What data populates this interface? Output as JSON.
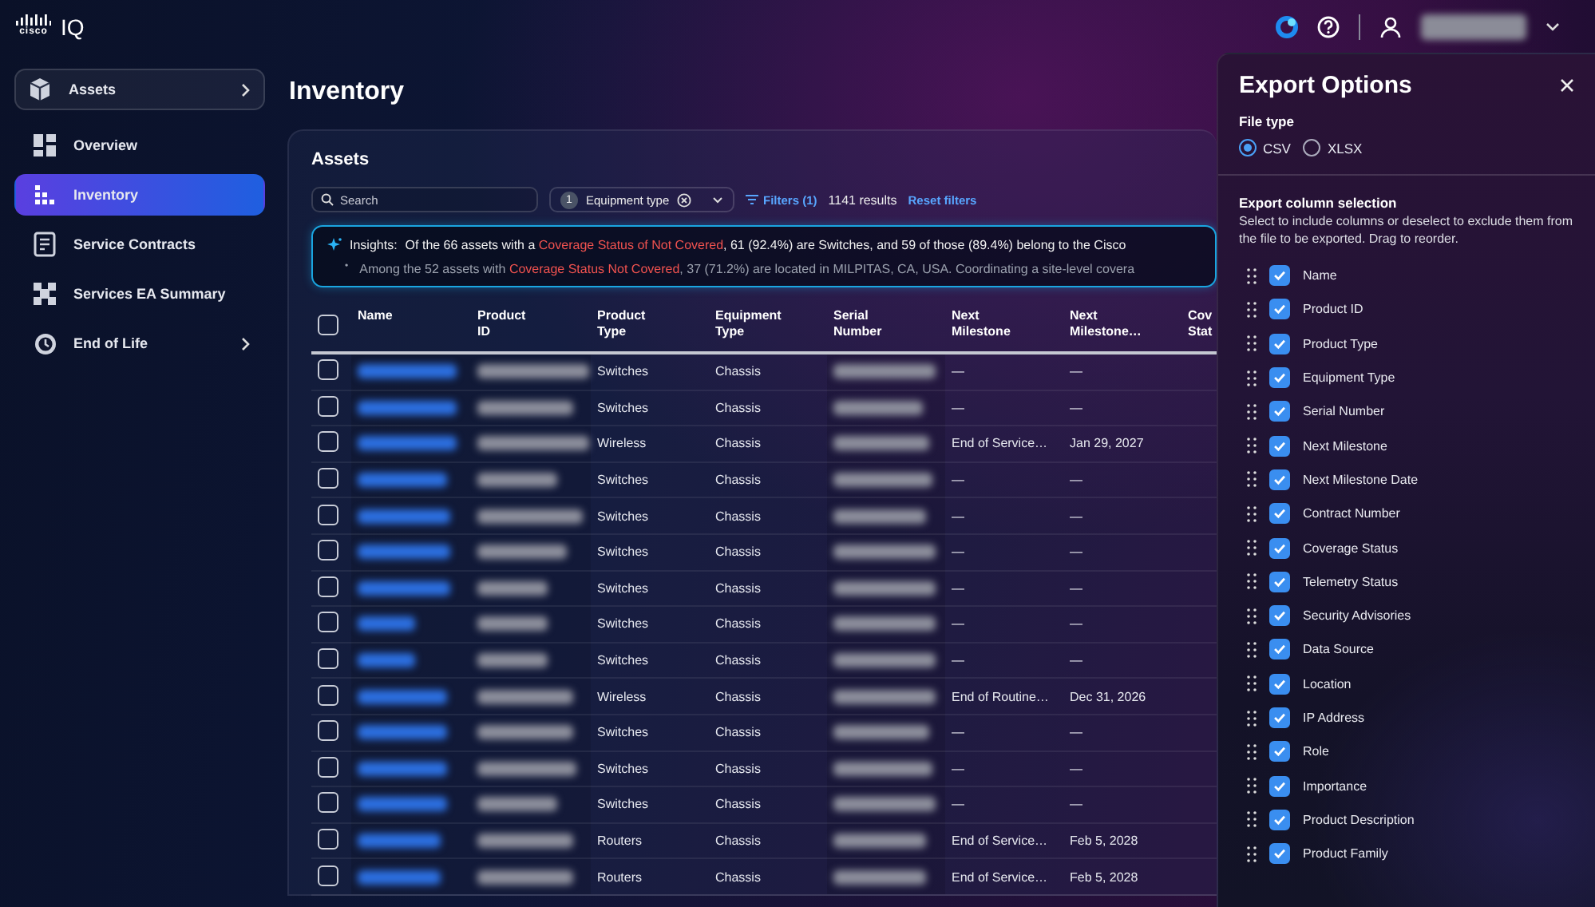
{
  "top_bar": {
    "logo_mark": "cisco",
    "product": "IQ"
  },
  "sidebar": {
    "items": [
      {
        "label": "Assets",
        "kind": "section",
        "selected": false,
        "has_submenu": true
      },
      {
        "label": "Overview",
        "kind": "page",
        "selected": false,
        "has_submenu": false
      },
      {
        "label": "Inventory",
        "kind": "page",
        "selected": true,
        "has_submenu": false
      },
      {
        "label": "Service Contracts",
        "kind": "page",
        "selected": false,
        "has_submenu": false
      },
      {
        "label": "Services EA Summary",
        "kind": "page",
        "selected": false,
        "has_submenu": false
      },
      {
        "label": "End of Life",
        "kind": "page",
        "selected": false,
        "has_submenu": true
      }
    ]
  },
  "page_title": "Inventory",
  "card": {
    "title": "Assets",
    "search": {
      "placeholder": "Search"
    },
    "filter_chip": {
      "count": "1",
      "label": "Equipment type"
    },
    "filters_link": "Filters (1)",
    "results": "1141 results",
    "reset_link": "Reset filters",
    "insights": {
      "label": "Insights:",
      "bullet": "•",
      "lines": [
        [
          {
            "text": "Of the 66 assets with a ",
            "kind": "plain"
          },
          {
            "text": "Coverage Status of Not Covered",
            "kind": "alert"
          },
          {
            "text": ", 61 (92.4%) are Switches, and 59 of those (89.4%) belong to the Cisco",
            "kind": "plain"
          }
        ],
        [
          {
            "text": "Among the 52 assets with ",
            "kind": "plain"
          },
          {
            "text": "Coverage Status Not Covered",
            "kind": "alert"
          },
          {
            "text": ", 37 (71.2%) are located in MILPITAS, CA, USA. Coordinating a site-level covera",
            "kind": "plain"
          }
        ]
      ]
    },
    "table": {
      "columns": [
        "Name",
        "Product ID",
        "Product Type",
        "Equipment Type",
        "Serial Number",
        "Next Milestone",
        "Next Milestone…",
        "Cov Stat"
      ],
      "select_all": {
        "checked": false
      },
      "rows": [
        {
          "checked": false,
          "product_type": "Switches",
          "equipment_type": "Chassis",
          "next_milestone": "—",
          "next_milestone_date": "—"
        },
        {
          "checked": false,
          "product_type": "Switches",
          "equipment_type": "Chassis",
          "next_milestone": "—",
          "next_milestone_date": "—"
        },
        {
          "checked": false,
          "product_type": "Wireless",
          "equipment_type": "Chassis",
          "next_milestone": "End of Service…",
          "next_milestone_date": "Jan 29, 2027"
        },
        {
          "checked": false,
          "product_type": "Switches",
          "equipment_type": "Chassis",
          "next_milestone": "—",
          "next_milestone_date": "—"
        },
        {
          "checked": false,
          "product_type": "Switches",
          "equipment_type": "Chassis",
          "next_milestone": "—",
          "next_milestone_date": "—"
        },
        {
          "checked": false,
          "product_type": "Switches",
          "equipment_type": "Chassis",
          "next_milestone": "—",
          "next_milestone_date": "—"
        },
        {
          "checked": false,
          "product_type": "Switches",
          "equipment_type": "Chassis",
          "next_milestone": "—",
          "next_milestone_date": "—"
        },
        {
          "checked": false,
          "product_type": "Switches",
          "equipment_type": "Chassis",
          "next_milestone": "—",
          "next_milestone_date": "—"
        },
        {
          "checked": false,
          "product_type": "Switches",
          "equipment_type": "Chassis",
          "next_milestone": "—",
          "next_milestone_date": "—"
        },
        {
          "checked": false,
          "product_type": "Wireless",
          "equipment_type": "Chassis",
          "next_milestone": "End of Routine…",
          "next_milestone_date": "Dec 31, 2026"
        },
        {
          "checked": false,
          "product_type": "Switches",
          "equipment_type": "Chassis",
          "next_milestone": "—",
          "next_milestone_date": "—"
        },
        {
          "checked": false,
          "product_type": "Switches",
          "equipment_type": "Chassis",
          "next_milestone": "—",
          "next_milestone_date": "—"
        },
        {
          "checked": false,
          "product_type": "Switches",
          "equipment_type": "Chassis",
          "next_milestone": "—",
          "next_milestone_date": "—"
        },
        {
          "checked": false,
          "product_type": "Routers",
          "equipment_type": "Chassis",
          "next_milestone": "End of Service…",
          "next_milestone_date": "Feb 5, 2028"
        },
        {
          "checked": false,
          "product_type": "Routers",
          "equipment_type": "Chassis",
          "next_milestone": "End of Service…",
          "next_milestone_date": "Feb 5, 2028"
        }
      ]
    }
  },
  "export_panel": {
    "title": "Export Options",
    "file_type": {
      "label": "File type",
      "options": [
        {
          "label": "CSV",
          "selected": true
        },
        {
          "label": "XLSX",
          "selected": false
        }
      ]
    },
    "columns_heading": "Export column selection",
    "columns_hint": "Select to include columns or deselect to exclude them from the file to be exported. Drag to reorder.",
    "columns": [
      {
        "label": "Name",
        "checked": true
      },
      {
        "label": "Product ID",
        "checked": true
      },
      {
        "label": "Product Type",
        "checked": true
      },
      {
        "label": "Equipment Type",
        "checked": true
      },
      {
        "label": "Serial Number",
        "checked": true
      },
      {
        "label": "Next Milestone",
        "checked": true
      },
      {
        "label": "Next Milestone Date",
        "checked": true
      },
      {
        "label": "Contract Number",
        "checked": true
      },
      {
        "label": "Coverage Status",
        "checked": true
      },
      {
        "label": "Telemetry Status",
        "checked": true
      },
      {
        "label": "Security Advisories",
        "checked": true
      },
      {
        "label": "Data Source",
        "checked": true
      },
      {
        "label": "Location",
        "checked": true
      },
      {
        "label": "IP Address",
        "checked": true
      },
      {
        "label": "Role",
        "checked": true
      },
      {
        "label": "Importance",
        "checked": true
      },
      {
        "label": "Product Description",
        "checked": true
      },
      {
        "label": "Product Family",
        "checked": true
      }
    ]
  }
}
